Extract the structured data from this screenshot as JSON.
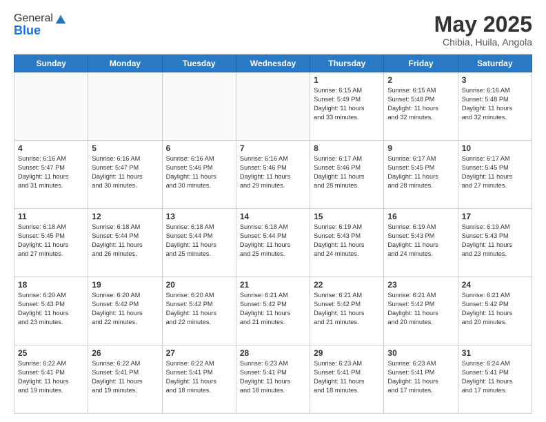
{
  "header": {
    "logo_line1": "General",
    "logo_line2": "Blue",
    "month_title": "May 2025",
    "location": "Chibia, Huila, Angola"
  },
  "days_of_week": [
    "Sunday",
    "Monday",
    "Tuesday",
    "Wednesday",
    "Thursday",
    "Friday",
    "Saturday"
  ],
  "weeks": [
    [
      {
        "day": "",
        "text": ""
      },
      {
        "day": "",
        "text": ""
      },
      {
        "day": "",
        "text": ""
      },
      {
        "day": "",
        "text": ""
      },
      {
        "day": "1",
        "text": "Sunrise: 6:15 AM\nSunset: 5:49 PM\nDaylight: 11 hours\nand 33 minutes."
      },
      {
        "day": "2",
        "text": "Sunrise: 6:15 AM\nSunset: 5:48 PM\nDaylight: 11 hours\nand 32 minutes."
      },
      {
        "day": "3",
        "text": "Sunrise: 6:16 AM\nSunset: 5:48 PM\nDaylight: 11 hours\nand 32 minutes."
      }
    ],
    [
      {
        "day": "4",
        "text": "Sunrise: 6:16 AM\nSunset: 5:47 PM\nDaylight: 11 hours\nand 31 minutes."
      },
      {
        "day": "5",
        "text": "Sunrise: 6:16 AM\nSunset: 5:47 PM\nDaylight: 11 hours\nand 30 minutes."
      },
      {
        "day": "6",
        "text": "Sunrise: 6:16 AM\nSunset: 5:46 PM\nDaylight: 11 hours\nand 30 minutes."
      },
      {
        "day": "7",
        "text": "Sunrise: 6:16 AM\nSunset: 5:46 PM\nDaylight: 11 hours\nand 29 minutes."
      },
      {
        "day": "8",
        "text": "Sunrise: 6:17 AM\nSunset: 5:46 PM\nDaylight: 11 hours\nand 28 minutes."
      },
      {
        "day": "9",
        "text": "Sunrise: 6:17 AM\nSunset: 5:45 PM\nDaylight: 11 hours\nand 28 minutes."
      },
      {
        "day": "10",
        "text": "Sunrise: 6:17 AM\nSunset: 5:45 PM\nDaylight: 11 hours\nand 27 minutes."
      }
    ],
    [
      {
        "day": "11",
        "text": "Sunrise: 6:18 AM\nSunset: 5:45 PM\nDaylight: 11 hours\nand 27 minutes."
      },
      {
        "day": "12",
        "text": "Sunrise: 6:18 AM\nSunset: 5:44 PM\nDaylight: 11 hours\nand 26 minutes."
      },
      {
        "day": "13",
        "text": "Sunrise: 6:18 AM\nSunset: 5:44 PM\nDaylight: 11 hours\nand 25 minutes."
      },
      {
        "day": "14",
        "text": "Sunrise: 6:18 AM\nSunset: 5:44 PM\nDaylight: 11 hours\nand 25 minutes."
      },
      {
        "day": "15",
        "text": "Sunrise: 6:19 AM\nSunset: 5:43 PM\nDaylight: 11 hours\nand 24 minutes."
      },
      {
        "day": "16",
        "text": "Sunrise: 6:19 AM\nSunset: 5:43 PM\nDaylight: 11 hours\nand 24 minutes."
      },
      {
        "day": "17",
        "text": "Sunrise: 6:19 AM\nSunset: 5:43 PM\nDaylight: 11 hours\nand 23 minutes."
      }
    ],
    [
      {
        "day": "18",
        "text": "Sunrise: 6:20 AM\nSunset: 5:43 PM\nDaylight: 11 hours\nand 23 minutes."
      },
      {
        "day": "19",
        "text": "Sunrise: 6:20 AM\nSunset: 5:42 PM\nDaylight: 11 hours\nand 22 minutes."
      },
      {
        "day": "20",
        "text": "Sunrise: 6:20 AM\nSunset: 5:42 PM\nDaylight: 11 hours\nand 22 minutes."
      },
      {
        "day": "21",
        "text": "Sunrise: 6:21 AM\nSunset: 5:42 PM\nDaylight: 11 hours\nand 21 minutes."
      },
      {
        "day": "22",
        "text": "Sunrise: 6:21 AM\nSunset: 5:42 PM\nDaylight: 11 hours\nand 21 minutes."
      },
      {
        "day": "23",
        "text": "Sunrise: 6:21 AM\nSunset: 5:42 PM\nDaylight: 11 hours\nand 20 minutes."
      },
      {
        "day": "24",
        "text": "Sunrise: 6:21 AM\nSunset: 5:42 PM\nDaylight: 11 hours\nand 20 minutes."
      }
    ],
    [
      {
        "day": "25",
        "text": "Sunrise: 6:22 AM\nSunset: 5:41 PM\nDaylight: 11 hours\nand 19 minutes."
      },
      {
        "day": "26",
        "text": "Sunrise: 6:22 AM\nSunset: 5:41 PM\nDaylight: 11 hours\nand 19 minutes."
      },
      {
        "day": "27",
        "text": "Sunrise: 6:22 AM\nSunset: 5:41 PM\nDaylight: 11 hours\nand 18 minutes."
      },
      {
        "day": "28",
        "text": "Sunrise: 6:23 AM\nSunset: 5:41 PM\nDaylight: 11 hours\nand 18 minutes."
      },
      {
        "day": "29",
        "text": "Sunrise: 6:23 AM\nSunset: 5:41 PM\nDaylight: 11 hours\nand 18 minutes."
      },
      {
        "day": "30",
        "text": "Sunrise: 6:23 AM\nSunset: 5:41 PM\nDaylight: 11 hours\nand 17 minutes."
      },
      {
        "day": "31",
        "text": "Sunrise: 6:24 AM\nSunset: 5:41 PM\nDaylight: 11 hours\nand 17 minutes."
      }
    ]
  ]
}
